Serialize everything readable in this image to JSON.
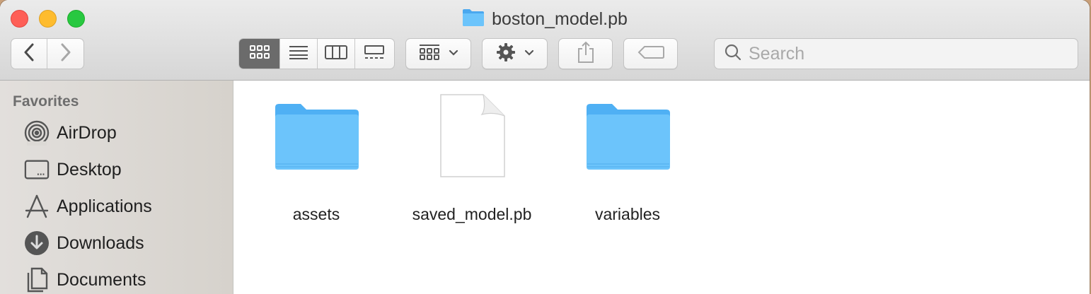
{
  "window": {
    "title": "boston_model.pb"
  },
  "toolbar": {
    "back_icon": "chevron-left-icon",
    "forward_icon": "chevron-right-icon",
    "view_modes": [
      "icon-view",
      "list-view",
      "column-view",
      "gallery-view"
    ],
    "active_view": "icon-view",
    "group_icon": "group-by-icon",
    "action_icon": "gear-icon",
    "share_icon": "share-icon",
    "tag_icon": "tag-icon"
  },
  "search": {
    "placeholder": "Search"
  },
  "sidebar": {
    "heading": "Favorites",
    "items": [
      {
        "label": "AirDrop",
        "icon": "airdrop-icon"
      },
      {
        "label": "Desktop",
        "icon": "desktop-icon"
      },
      {
        "label": "Applications",
        "icon": "applications-icon"
      },
      {
        "label": "Downloads",
        "icon": "downloads-icon"
      },
      {
        "label": "Documents",
        "icon": "documents-icon"
      }
    ]
  },
  "files": [
    {
      "name": "assets",
      "kind": "folder"
    },
    {
      "name": "saved_model.pb",
      "kind": "document"
    },
    {
      "name": "variables",
      "kind": "folder"
    }
  ],
  "colors": {
    "folder": "#6cc4fb",
    "active_segment": "#6b6b6b",
    "close": "#fe5f57",
    "minimize": "#febc2e",
    "zoom": "#28c840"
  }
}
